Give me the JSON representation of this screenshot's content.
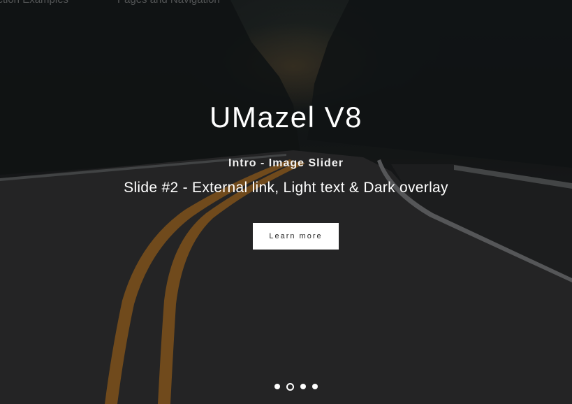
{
  "nav": {
    "items": [
      "ection Examples",
      "Pages and Navigation"
    ]
  },
  "slider": {
    "title": "UMazel V8",
    "subtitle": "Intro - Image Slider",
    "description": "Slide #2 - External link, Light text & Dark overlay",
    "cta_label": "Learn more",
    "total_slides": 4,
    "active_slide": 2
  },
  "colors": {
    "text": "#ffffff",
    "button_bg": "#ffffff",
    "button_text": "#2a2a2a",
    "road_line": "#b5782e"
  },
  "icons": {
    "background": "road-forest-photo"
  }
}
